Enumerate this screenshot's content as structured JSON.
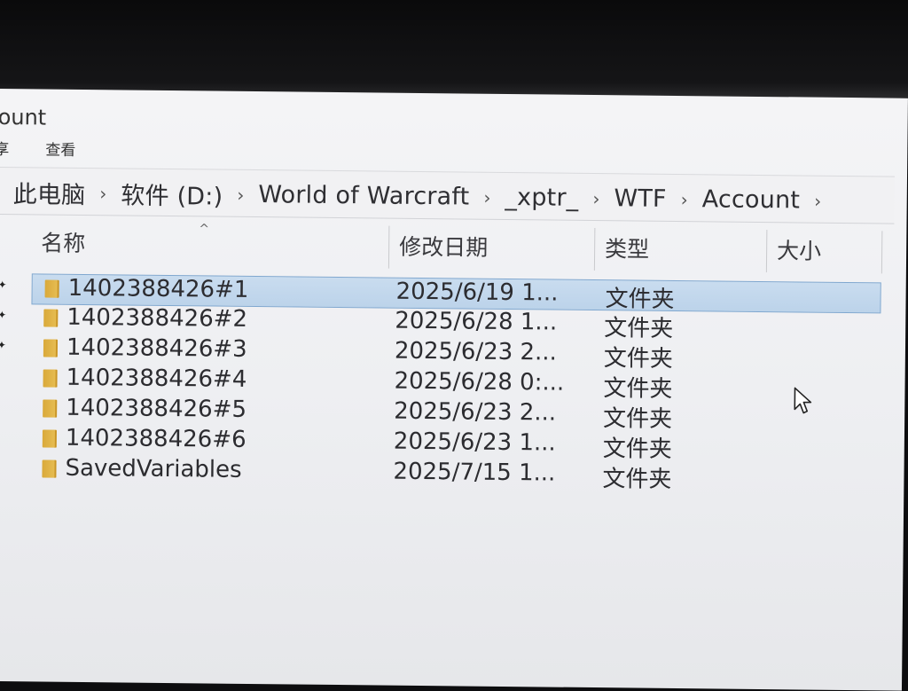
{
  "window": {
    "title": "ount"
  },
  "ribbon": {
    "tabs": [
      "享",
      "查看"
    ]
  },
  "address_bar": {
    "crumbs": [
      "此电脑",
      "软件 (D:)",
      "World of Warcraft",
      "_xptr_",
      "WTF",
      "Account"
    ]
  },
  "columns": {
    "name": "名称",
    "date": "修改日期",
    "type": "类型",
    "size": "大小"
  },
  "files": [
    {
      "name": "1402388426#1",
      "date": "2025/6/19 1...",
      "type": "文件夹",
      "selected": true
    },
    {
      "name": "1402388426#2",
      "date": "2025/6/28 1...",
      "type": "文件夹",
      "selected": false
    },
    {
      "name": "1402388426#3",
      "date": "2025/6/23 2...",
      "type": "文件夹",
      "selected": false
    },
    {
      "name": "1402388426#4",
      "date": "2025/6/28 0:...",
      "type": "文件夹",
      "selected": false
    },
    {
      "name": "1402388426#5",
      "date": "2025/6/23 2...",
      "type": "文件夹",
      "selected": false
    },
    {
      "name": "1402388426#6",
      "date": "2025/6/23 1...",
      "type": "文件夹",
      "selected": false
    },
    {
      "name": "SavedVariables",
      "date": "2025/7/15 1...",
      "type": "文件夹",
      "selected": false
    }
  ],
  "icons": {
    "folder": "folder-icon",
    "breadcrumb_separator": "chevron-right-icon",
    "sort_indicator": "sort-ascending-icon",
    "pointer": "mouse-pointer-icon"
  },
  "colors": {
    "selection": "#c4d9ee",
    "selection_border": "#7fa7cf",
    "folder": "#e0b54a"
  }
}
